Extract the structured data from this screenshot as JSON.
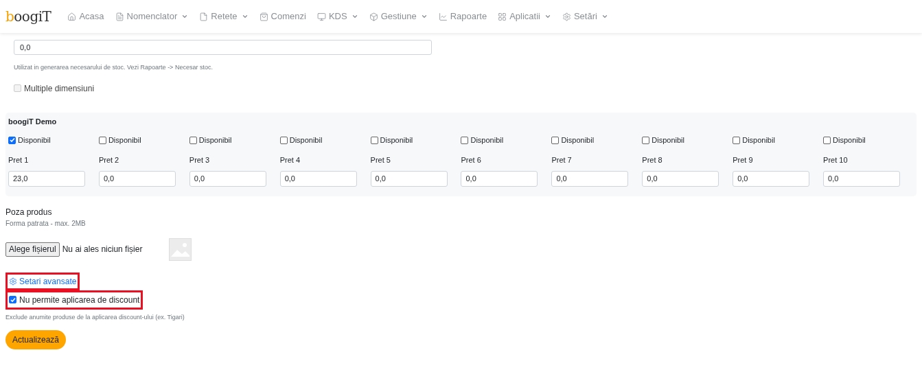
{
  "nav": {
    "logo": "boogiT",
    "items": [
      {
        "label": "Acasa",
        "dropdown": false
      },
      {
        "label": "Nomenclator",
        "dropdown": true
      },
      {
        "label": "Retete",
        "dropdown": true
      },
      {
        "label": "Comenzi",
        "dropdown": false
      },
      {
        "label": "KDS",
        "dropdown": true
      },
      {
        "label": "Gestiune",
        "dropdown": true
      },
      {
        "label": "Rapoarte",
        "dropdown": false
      },
      {
        "label": "Aplicatii",
        "dropdown": true
      },
      {
        "label": "Setări",
        "dropdown": true
      }
    ]
  },
  "stock": {
    "value": "0,0",
    "help": "Utilizat in generarea necesarului de stoc. Vezi Rapoarte -> Necesar stoc."
  },
  "multiple_dimensions": {
    "label": "Multiple dimensiuni",
    "checked": false,
    "disabled": true
  },
  "location": {
    "title": "boogiT Demo",
    "prices": [
      {
        "available_label": "Disponibil",
        "available": true,
        "label": "Pret 1",
        "value": "23,0"
      },
      {
        "available_label": "Disponibil",
        "available": false,
        "label": "Pret 2",
        "value": "0,0"
      },
      {
        "available_label": "Disponibil",
        "available": false,
        "label": "Pret 3",
        "value": "0,0"
      },
      {
        "available_label": "Disponibil",
        "available": false,
        "label": "Pret 4",
        "value": "0,0"
      },
      {
        "available_label": "Disponibil",
        "available": false,
        "label": "Pret 5",
        "value": "0,0"
      },
      {
        "available_label": "Disponibil",
        "available": false,
        "label": "Pret 6",
        "value": "0,0"
      },
      {
        "available_label": "Disponibil",
        "available": false,
        "label": "Pret 7",
        "value": "0,0"
      },
      {
        "available_label": "Disponibil",
        "available": false,
        "label": "Pret 8",
        "value": "0,0"
      },
      {
        "available_label": "Disponibil",
        "available": false,
        "label": "Pret 9",
        "value": "0,0"
      },
      {
        "available_label": "Disponibil",
        "available": false,
        "label": "Pret 10",
        "value": "0,0"
      }
    ]
  },
  "photo": {
    "title": "Poza produs",
    "hint": "Forma patrata - max. 2MB",
    "button": "Alege fișierul",
    "status": "Nu ai ales niciun fișier"
  },
  "advanced": {
    "label": "Setari avansate",
    "highlighted": true
  },
  "no_discount": {
    "label": "Nu permite aplicarea de discount",
    "checked": true,
    "highlighted": true,
    "help": "Exclude anumite produse de la aplicarea discount-ului (ex. Tigari)"
  },
  "submit": "Actualizează"
}
